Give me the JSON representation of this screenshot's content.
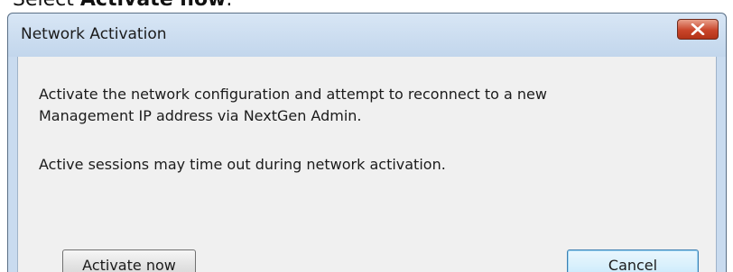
{
  "instruction": {
    "prefix": "Select ",
    "bold": "Activate now",
    "suffix": "."
  },
  "dialog": {
    "title": "Network Activation",
    "close_icon": "close-icon",
    "message_line1": "Activate the network configuration and attempt to reconnect to a new",
    "message_line2": "Management IP address via NextGen Admin.",
    "message_line3": "Active sessions may time out during network activation.",
    "activate_label": "Activate now",
    "cancel_label": "Cancel"
  },
  "colors": {
    "close_button": "#c9452a",
    "title_bar": "#c9dbef",
    "content_bg": "#f0f0f0"
  }
}
